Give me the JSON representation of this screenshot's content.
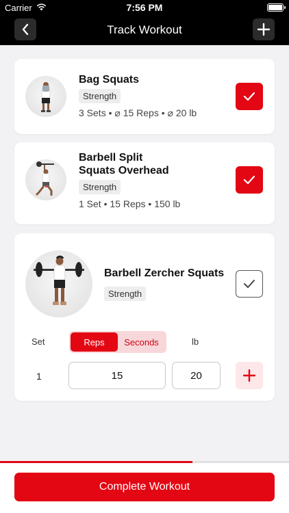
{
  "status_bar": {
    "carrier": "Carrier",
    "time": "7:56 PM"
  },
  "nav": {
    "title": "Track Workout"
  },
  "exercises": [
    {
      "name": "Bag Squats",
      "category": "Strength",
      "summary": "3 Sets • ⌀ 15 Reps • ⌀ 20 lb",
      "completed": true
    },
    {
      "name_line1": "Barbell Split",
      "name_line2": "Squats Overhead",
      "category": "Strength",
      "summary": "1 Set • 15 Reps • 150 lb",
      "completed": true
    },
    {
      "name": "Barbell Zercher Squats",
      "category": "Strength",
      "completed": false
    }
  ],
  "set_editor": {
    "set_label": "Set",
    "modes": [
      "Reps",
      "Seconds"
    ],
    "active_mode": "Reps",
    "unit_label": "lb",
    "rows": [
      {
        "set": "1",
        "reps": "15",
        "weight": "20"
      }
    ]
  },
  "progress": {
    "fraction": 0.665
  },
  "footer": {
    "complete_label": "Complete Workout"
  },
  "colors": {
    "accent": "#e30613",
    "accent_light": "#f8d7da"
  }
}
